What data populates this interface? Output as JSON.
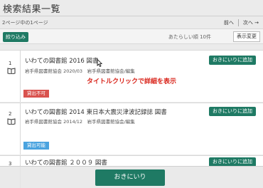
{
  "header": {
    "title": "検索結果一覧",
    "page_info": "2ページ中の1ページ",
    "prev_label": "前へ",
    "next_label": "次へ →"
  },
  "toolbar": {
    "filter_label": "絞り込み",
    "sort_label": "あたらしい順 10件",
    "display_label": "表示変更"
  },
  "results": [
    {
      "number": "1",
      "title": "いわての図書館 2016 図書",
      "meta": "岩手県図書館協会 2020/03　岩手県図書館協会/編集",
      "fav_label": "おきにいりに追加",
      "status": "貸出不可",
      "status_color": "#d9534f"
    },
    {
      "number": "2",
      "title": "いわての図書館 2014 東日本大震災津波記録誌 図書",
      "meta": "岩手県図書館協会 2014/12　岩手県図書館協会/編集",
      "fav_label": "おきにいりに追加",
      "status": "貸出可能",
      "status_color": "#4aa3df"
    },
    {
      "number": "3",
      "title": "いわての図書館 ２００９ 図書",
      "fav_label": "おきにいりに追加"
    }
  ],
  "hint_text": "タイトルクリックで詳細を表示",
  "bottom": {
    "favorites_label": "おきにいり"
  },
  "colors": {
    "accent": "#1f7a64",
    "hint": "#d9261c"
  },
  "icons": [
    "book-icon",
    "mouse-cursor-icon"
  ]
}
